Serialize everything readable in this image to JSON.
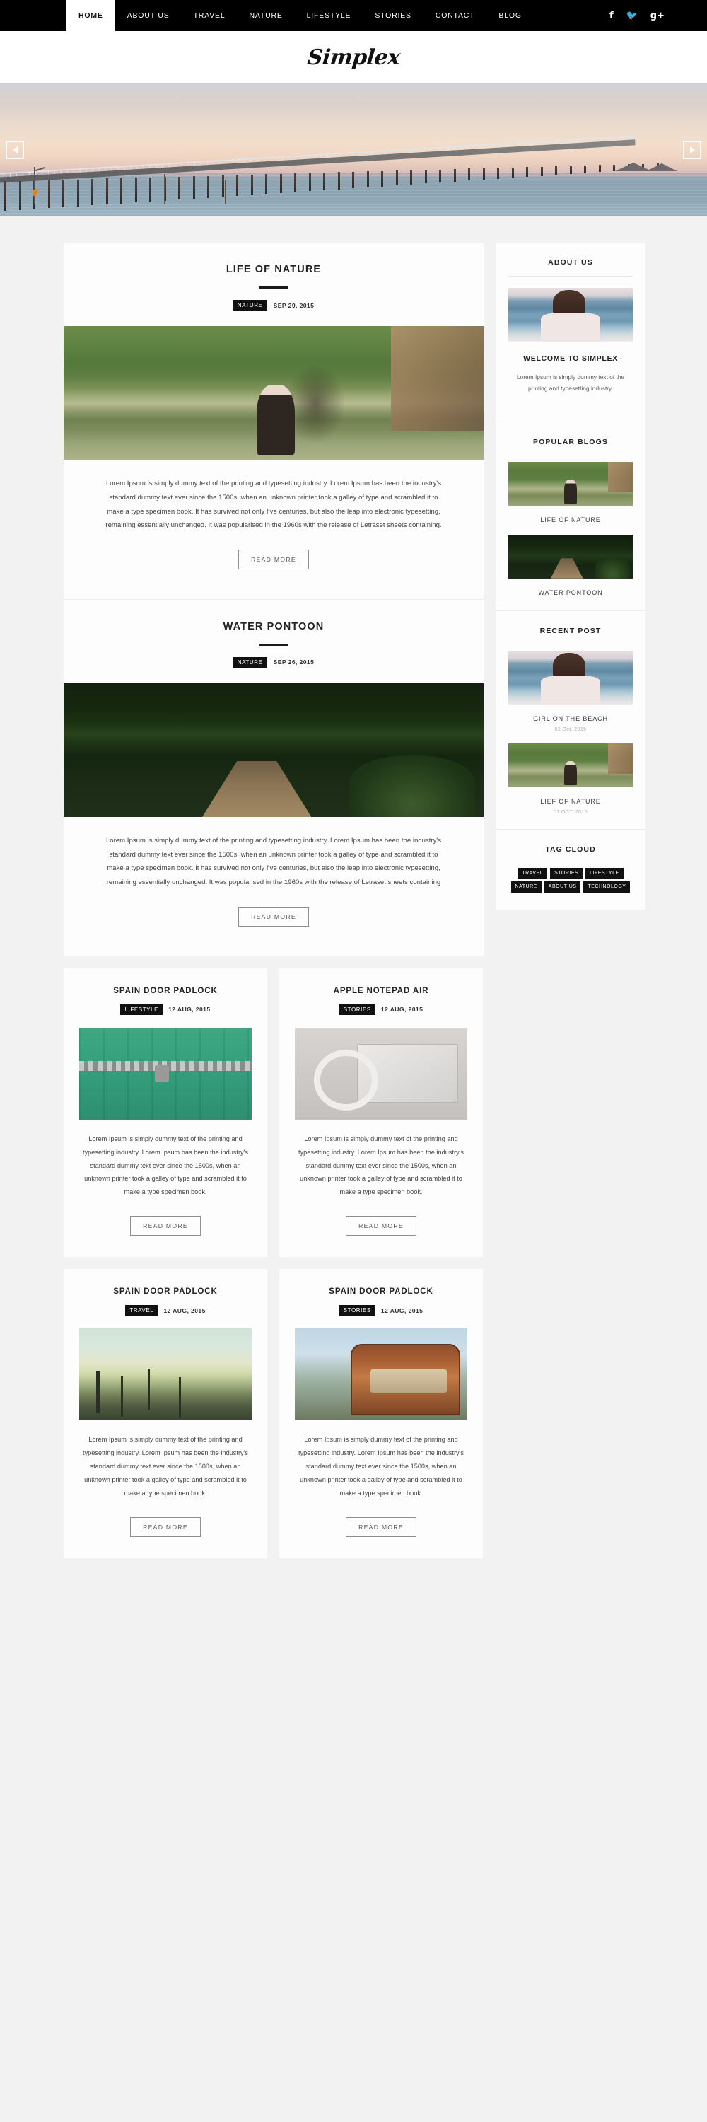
{
  "nav": {
    "items": [
      {
        "label": "HOME",
        "active": true
      },
      {
        "label": "ABOUT US",
        "active": false
      },
      {
        "label": "TRAVEL",
        "active": false
      },
      {
        "label": "NATURE",
        "active": false
      },
      {
        "label": "LIFESTYLE",
        "active": false
      },
      {
        "label": "STORIES",
        "active": false
      },
      {
        "label": "CONTACT",
        "active": false
      },
      {
        "label": "BLOG",
        "active": false
      }
    ],
    "social": [
      {
        "name": "facebook-icon",
        "glyph": "f"
      },
      {
        "name": "twitter-icon",
        "glyph": "🐦"
      },
      {
        "name": "google-plus-icon",
        "glyph": "g+"
      }
    ]
  },
  "brand": {
    "logo": "Simplex"
  },
  "hero": {
    "prev_label": "◀",
    "next_label": "▶"
  },
  "posts": [
    {
      "title": "LIFE OF NATURE",
      "category": "NATURE",
      "date": "SEP 29, 2015",
      "photo": "ph-nature",
      "body": "Lorem Ipsum is simply dummy text of the printing and typesetting industry. Lorem Ipsum has been the industry's standard dummy text ever since the 1500s, when an unknown printer took a galley of type and scrambled it to make a type specimen book. It has survived not only five centuries, but also the leap into electronic typesetting, remaining essentially unchanged. It was popularised in the 1960s with the release of Letraset sheets containing.",
      "read_more": "READ MORE"
    },
    {
      "title": "WATER PONTOON",
      "category": "NATURE",
      "date": "SEP 26, 2015",
      "photo": "ph-pontoon",
      "body": "Lorem Ipsum is simply dummy text of the printing and typesetting industry. Lorem Ipsum has been the industry's standard dummy text ever since the 1500s, when an unknown printer took a galley of type and scrambled it to make a type specimen book. It has survived not only five centuries, but also the leap into electronic typesetting, remaining essentially unchanged. It was popularised in the 1960s with the release of Letraset sheets containing",
      "read_more": "READ MORE"
    }
  ],
  "grid_posts": [
    {
      "title": "SPAIN DOOR PADLOCK",
      "category": "LIFESTYLE",
      "date": "12 AUG, 2015",
      "photo": "ph-padlock",
      "body": "Lorem Ipsum is simply dummy text of the printing and typesetting industry. Lorem Ipsum has been the industry's standard dummy text ever since the 1500s, when an unknown printer took a galley of type and scrambled it to make a type specimen book.",
      "read_more": "READ MORE"
    },
    {
      "title": "APPLE NOTEPAD AIR",
      "category": "STORIES",
      "date": "12 AUG, 2015",
      "photo": "ph-laptop",
      "body": "Lorem Ipsum is simply dummy text of the printing and typesetting industry. Lorem Ipsum has been the industry's standard dummy text ever since the 1500s, when an unknown printer took a galley of type and scrambled it to make a type specimen book.",
      "read_more": "READ MORE"
    },
    {
      "title": "SPAIN DOOR PADLOCK",
      "category": "TRAVEL",
      "date": "12 AUG, 2015",
      "photo": "ph-beach",
      "body": "Lorem Ipsum is simply dummy text of the printing and typesetting industry. Lorem Ipsum has been the industry's standard dummy text ever since the 1500s, when an unknown printer took a galley of type and scrambled it to make a type specimen book.",
      "read_more": "READ MORE"
    },
    {
      "title": "SPAIN DOOR PADLOCK",
      "category": "STORIES",
      "date": "12 AUG, 2015",
      "photo": "ph-tram",
      "body": "Lorem Ipsum is simply dummy text of the printing and typesetting industry. Lorem Ipsum has been the industry's standard dummy text ever since the 1500s, when an unknown printer took a galley of type and scrambled it to make a type specimen book.",
      "read_more": "READ MORE"
    }
  ],
  "sidebar": {
    "about": {
      "title": "ABOUT US",
      "photo": "ph-girlbeach",
      "welcome_title": "WELCOME TO SIMPLEX",
      "welcome_text": "Lorem Ipsum is simply dummy text of the printing and typesetting industry."
    },
    "popular": {
      "title": "POPULAR BLOGS",
      "items": [
        {
          "title": "LIFE OF NATURE",
          "photo": "ph-nature-sm"
        },
        {
          "title": "WATER PONTOON",
          "photo": "ph-pontoon-sm"
        }
      ]
    },
    "recent": {
      "title": "RECENT POST",
      "items": [
        {
          "title": "GIRL ON THE BEACH",
          "date": "02 Oct, 2015",
          "photo": "ph-girlbeach"
        },
        {
          "title": "LIEF OF NATURE",
          "date": "01 OCT, 2015",
          "photo": "ph-nature-sm"
        }
      ]
    },
    "tagcloud": {
      "title": "TAG CLOUD",
      "tags": [
        "TRAVEL",
        "STORIES",
        "LIFESTYLE",
        "NATURE",
        "ABOUT US",
        "TECHNOLOGY"
      ]
    }
  },
  "theme": {
    "accent": "#111111",
    "page_bg": "#f2f2f2",
    "card_bg": "#fdfdfd"
  }
}
